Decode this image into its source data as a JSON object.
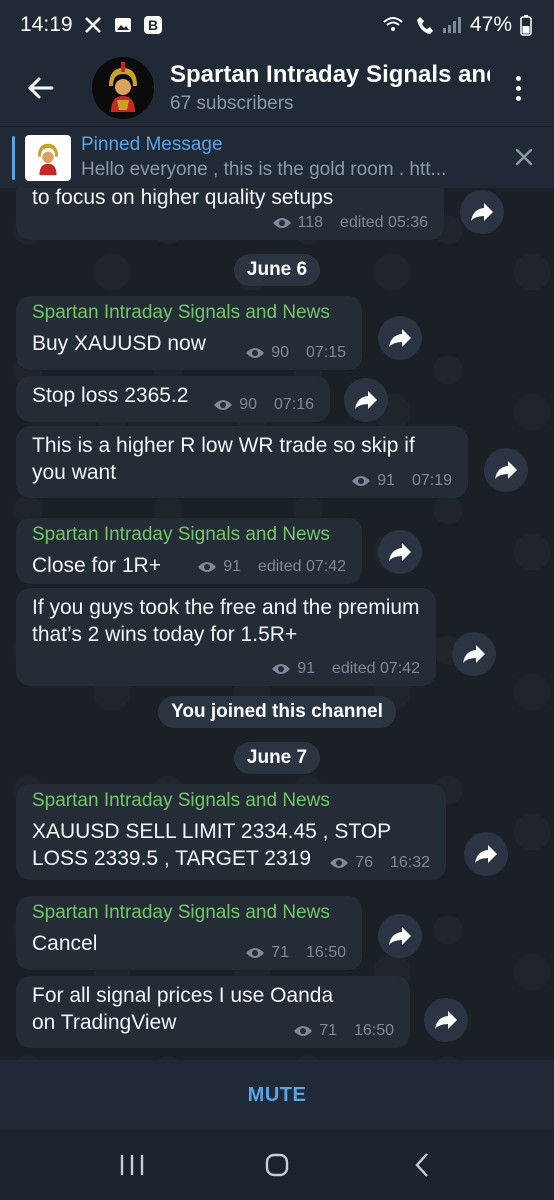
{
  "status": {
    "time": "14:19",
    "battery": "47%"
  },
  "header": {
    "title": "Spartan Intraday Signals and News",
    "subscribers": "67 subscribers"
  },
  "pinned": {
    "title": "Pinned Message",
    "text": "Hello everyone , this is the gold room .   htt..."
  },
  "messages": [
    {
      "text": "to focus on higher quality setups",
      "views": "118",
      "time": "edited 05:36"
    },
    {
      "sender": "Spartan Intraday Signals and News",
      "text": "Buy XAUUSD now",
      "views": "90",
      "time": "07:15"
    },
    {
      "text": "Stop loss 2365.2",
      "views": "90",
      "time": "07:16"
    },
    {
      "text": "This is a higher R low WR trade so skip if you want",
      "views": "91",
      "time": "07:19"
    },
    {
      "sender": "Spartan Intraday Signals and News",
      "text": "Close for 1R+",
      "views": "91",
      "time": "edited 07:42"
    },
    {
      "text": "If you guys took the free and the premium that’s 2 wins today for 1.5R+",
      "views": "91",
      "time": "edited 07:42"
    },
    {
      "sender": "Spartan Intraday Signals and News",
      "text": "XAUUSD SELL LIMIT 2334.45 , STOP LOSS 2339.5 , TARGET 2319",
      "views": "76",
      "time": "16:32"
    },
    {
      "sender": "Spartan Intraday Signals and News",
      "text": "Cancel",
      "views": "71",
      "time": "16:50"
    },
    {
      "text": "For all signal prices I use Oanda on TradingView",
      "views": "71",
      "time": "16:50"
    }
  ],
  "dates": {
    "june6": "June 6",
    "joined": "You joined this channel",
    "june7": "June 7"
  },
  "footer": {
    "mute_label": "MUTE"
  },
  "colors": {
    "accent": "#5ea2e2",
    "sender": "#74c56b",
    "bubble": "#242c36"
  }
}
